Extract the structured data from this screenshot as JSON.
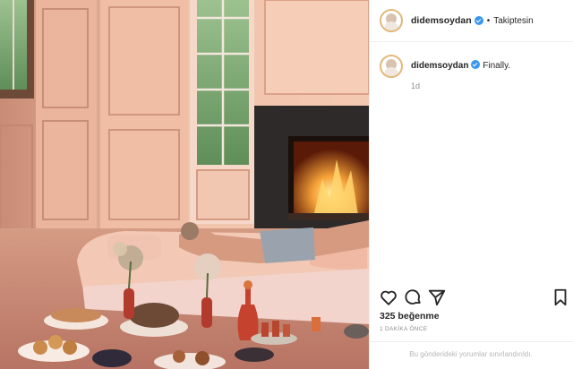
{
  "post": {
    "username": "didemsoydan",
    "dot": "•",
    "follow_status": "Takiptesin",
    "caption_username": "didemsoydan",
    "caption_text": "Finally.",
    "time_ago": "1d",
    "likes": "325 beğenme",
    "posted_ago": "1 DAKİKA ÖNCE",
    "comments_disabled": "Bu gönderideki yorumlar sınırlandırıldı."
  },
  "icons": {
    "verified": "verified-badge-icon",
    "like": "heart-icon",
    "comment": "comment-icon",
    "share": "share-icon",
    "save": "bookmark-icon"
  },
  "colors": {
    "verified_blue": "#3897f0",
    "muted_text": "#8e8e8e",
    "wall": "#e9b79e",
    "fire": "#f08a24"
  }
}
